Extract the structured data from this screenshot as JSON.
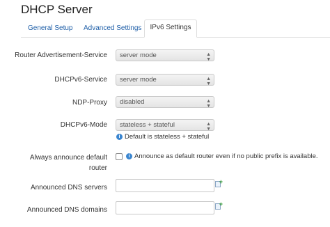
{
  "page": {
    "title": "DHCP Server"
  },
  "tabs": [
    {
      "label": "General Setup"
    },
    {
      "label": "Advanced Settings"
    },
    {
      "label": "IPv6 Settings"
    }
  ],
  "fields": {
    "ra_service": {
      "label": "Router Advertisement-Service",
      "value": "server mode"
    },
    "dhcpv6_service": {
      "label": "DHCPv6-Service",
      "value": "server mode"
    },
    "ndp_proxy": {
      "label": "NDP-Proxy",
      "value": "disabled"
    },
    "dhcpv6_mode": {
      "label": "DHCPv6-Mode",
      "value": "stateless + stateful",
      "hint": "Default is stateless + stateful"
    },
    "always_announce": {
      "label_line1": "Always announce default",
      "label_line2": "router",
      "checked": false,
      "hint": "Announce as default router even if no public prefix is available."
    },
    "dns_servers": {
      "label": "Announced DNS servers",
      "value": ""
    },
    "dns_domains": {
      "label": "Announced DNS domains",
      "value": ""
    }
  },
  "colors": {
    "link": "#1f5fa8",
    "info_icon": "#3b86d0",
    "add_icon_plus": "#2e9a2e"
  },
  "icons": {
    "select_arrows": "updown-arrows",
    "info": "info-icon",
    "add": "add-entry-icon"
  }
}
